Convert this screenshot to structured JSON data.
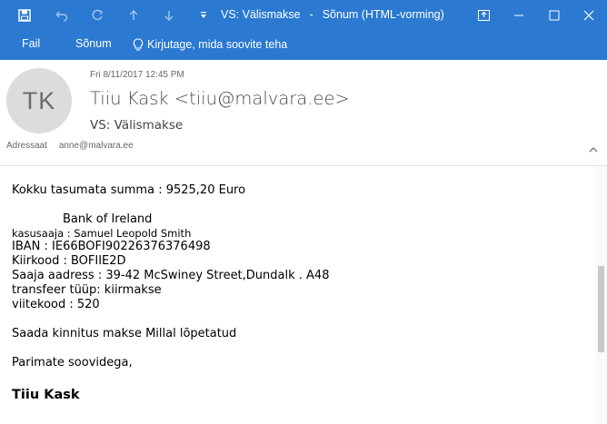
{
  "window": {
    "title_prefix": "VS: Välismakse",
    "title_sep": "-",
    "title_suffix": "Sõnum (HTML-vorming)"
  },
  "ribbon": {
    "tabs": [
      {
        "label": "Fail"
      },
      {
        "label": "Sõnum"
      }
    ],
    "tell_me": "Kirjutage, mida soovite teha"
  },
  "message": {
    "avatar_initials": "TK",
    "date": "Fri 8/11/2017 12:45 PM",
    "sender": "Tiiu Kask <tiiu@malvara.ee>",
    "subject": "VS: Välismakse",
    "to_label": "Adressaat",
    "to_value": "anne@malvara.ee"
  },
  "body": {
    "line1": "Kokku tasumata summa : 9525,20 Euro",
    "bank": "Bank of Ireland",
    "beneficiary": "kasusaaja : Samuel Leopold Smith",
    "iban": "IBAN : IE66BOFI90226376376498",
    "swift": "Kiirkood : BOFIIE2D",
    "address": "Saaja aadress :  39-42 McSwiney Street,Dundalk . A48",
    "transfer_type": "transfeer tüüp: kiirmakse",
    "reference": "viitekood : 520",
    "confirm": "Saada kinnitus makse Millal lõpetatud",
    "regards": "Parimate soovidega,",
    "signature": "Tiiu Kask"
  },
  "colors": {
    "accent": "#2b79d0",
    "avatar_bg": "#dcdcdc"
  },
  "icons": [
    "save-icon",
    "undo-icon",
    "redo-icon",
    "up-arrow-icon",
    "down-arrow-icon",
    "customize-qat-icon",
    "restore-ribbon-icon",
    "minimize-icon",
    "maximize-icon",
    "close-icon",
    "lightbulb-icon",
    "collapse-header-icon"
  ]
}
